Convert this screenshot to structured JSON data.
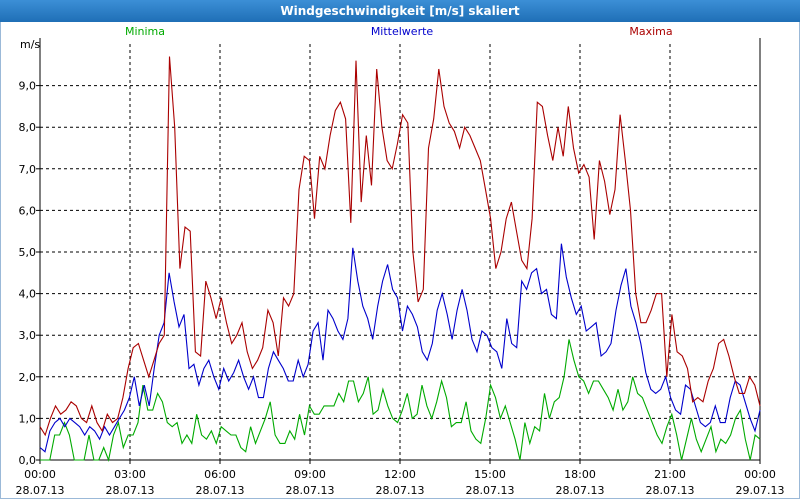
{
  "window": {
    "title": "Windgeschwindigkeit [m/s] skaliert"
  },
  "chart_data": {
    "type": "line",
    "title": "Windgeschwindigkeit [m/s] skaliert",
    "ylabel": "m/s",
    "ylim": [
      0,
      10
    ],
    "y_ticks": [
      "0,0",
      "1,0",
      "2,0",
      "3,0",
      "4,0",
      "5,0",
      "6,0",
      "7,0",
      "8,0",
      "9,0"
    ],
    "x_ticks": [
      {
        "time": "00:00",
        "date": "28.07.13"
      },
      {
        "time": "03:00",
        "date": "28.07.13"
      },
      {
        "time": "06:00",
        "date": "28.07.13"
      },
      {
        "time": "09:00",
        "date": "28.07.13"
      },
      {
        "time": "12:00",
        "date": "28.07.13"
      },
      {
        "time": "15:00",
        "date": "28.07.13"
      },
      {
        "time": "18:00",
        "date": "28.07.13"
      },
      {
        "time": "21:00",
        "date": "28.07.13"
      },
      {
        "time": "00:00",
        "date": "29.07.13"
      }
    ],
    "grid": true,
    "series": [
      {
        "name": "Minima",
        "color": "#00aa00",
        "values": [
          0.0,
          0.0,
          0.0,
          0.6,
          0.6,
          0.9,
          0.6,
          0.0,
          0.0,
          0.0,
          0.6,
          0.0,
          0.0,
          0.3,
          0.0,
          0.6,
          0.9,
          0.3,
          0.6,
          0.6,
          0.9,
          1.8,
          1.2,
          1.2,
          1.6,
          1.4,
          0.9,
          0.8,
          0.9,
          0.4,
          0.6,
          0.4,
          1.1,
          0.6,
          0.5,
          0.7,
          0.4,
          0.8,
          0.7,
          0.6,
          0.6,
          0.3,
          0.2,
          0.8,
          0.4,
          0.7,
          1.0,
          1.4,
          0.6,
          0.4,
          0.4,
          0.7,
          0.5,
          1.1,
          0.6,
          1.3,
          1.1,
          1.1,
          1.3,
          1.3,
          1.3,
          1.6,
          1.4,
          1.9,
          1.9,
          1.4,
          1.6,
          2.0,
          1.1,
          1.2,
          1.7,
          1.3,
          1.0,
          0.9,
          1.2,
          1.6,
          1.0,
          1.1,
          1.8,
          1.3,
          1.0,
          1.4,
          1.9,
          1.5,
          0.8,
          0.9,
          0.9,
          1.4,
          0.7,
          0.5,
          0.4,
          1.0,
          1.8,
          1.5,
          1.0,
          1.3,
          0.9,
          0.5,
          0.0,
          0.9,
          0.4,
          0.8,
          0.7,
          1.6,
          1.0,
          1.4,
          1.5,
          2.0,
          2.9,
          2.4,
          2.0,
          1.9,
          1.6,
          1.9,
          1.9,
          1.7,
          1.5,
          1.2,
          1.7,
          1.2,
          1.4,
          2.0,
          1.6,
          1.5,
          1.2,
          0.9,
          0.6,
          0.4,
          0.8,
          1.1,
          0.6,
          0.0,
          0.5,
          1.0,
          0.5,
          0.2,
          0.5,
          0.8,
          0.2,
          0.5,
          0.4,
          0.6,
          1.0,
          1.2,
          0.5,
          0.0,
          0.6,
          0.5
        ]
      },
      {
        "name": "Mittelwerte",
        "color": "#0000cc",
        "values": [
          0.3,
          0.2,
          0.7,
          0.9,
          1.0,
          0.8,
          1.0,
          0.9,
          0.8,
          0.6,
          0.8,
          0.7,
          0.5,
          0.8,
          0.6,
          0.8,
          1.0,
          1.2,
          1.5,
          2.0,
          1.3,
          1.8,
          1.3,
          2.2,
          3.0,
          3.3,
          4.5,
          3.8,
          3.2,
          3.5,
          2.2,
          2.3,
          1.8,
          2.2,
          2.4,
          2.0,
          1.7,
          2.2,
          1.9,
          2.1,
          2.4,
          2.0,
          1.7,
          2.0,
          1.5,
          1.5,
          2.2,
          2.6,
          2.4,
          2.2,
          1.9,
          1.9,
          2.4,
          2.0,
          2.3,
          3.1,
          3.3,
          2.4,
          3.6,
          3.4,
          3.1,
          2.9,
          3.4,
          5.1,
          4.3,
          3.7,
          3.4,
          2.9,
          3.7,
          4.3,
          4.7,
          4.1,
          3.9,
          3.1,
          3.7,
          3.5,
          3.2,
          2.6,
          2.4,
          2.8,
          3.6,
          4.0,
          3.5,
          2.9,
          3.6,
          4.1,
          3.6,
          2.9,
          2.6,
          3.1,
          3.0,
          2.7,
          2.6,
          2.2,
          3.4,
          2.8,
          2.7,
          4.3,
          4.1,
          4.5,
          4.6,
          4.0,
          4.1,
          3.5,
          3.4,
          5.2,
          4.4,
          3.9,
          3.5,
          3.7,
          3.1,
          3.2,
          3.3,
          2.5,
          2.6,
          2.8,
          3.6,
          4.2,
          4.6,
          3.7,
          3.3,
          2.8,
          2.1,
          1.7,
          1.6,
          1.7,
          2.0,
          1.5,
          1.2,
          1.1,
          1.8,
          1.7,
          1.3,
          0.9,
          0.8,
          0.9,
          1.3,
          0.9,
          0.9,
          1.5,
          1.9,
          1.8,
          1.4,
          1.0,
          0.7,
          1.2
        ]
      },
      {
        "name": "Maxima",
        "color": "#aa0000",
        "values": [
          0.8,
          0.6,
          1.0,
          1.3,
          1.1,
          1.2,
          1.4,
          1.3,
          1.0,
          0.9,
          1.3,
          0.9,
          0.7,
          1.1,
          0.9,
          1.0,
          1.5,
          2.2,
          2.7,
          2.8,
          2.4,
          2.0,
          2.4,
          2.8,
          3.0,
          9.7,
          8.0,
          4.6,
          5.6,
          5.5,
          2.6,
          2.5,
          4.3,
          3.9,
          3.4,
          3.9,
          3.3,
          2.8,
          3.0,
          3.3,
          2.6,
          2.2,
          2.4,
          2.7,
          3.6,
          3.3,
          2.5,
          3.9,
          3.7,
          4.0,
          6.5,
          7.3,
          7.2,
          5.8,
          7.3,
          7.0,
          7.8,
          8.4,
          8.6,
          8.2,
          5.7,
          9.6,
          6.2,
          7.8,
          6.6,
          9.4,
          8.0,
          7.2,
          7.0,
          7.6,
          8.3,
          8.1,
          5.0,
          3.8,
          4.1,
          7.5,
          8.2,
          9.4,
          8.5,
          8.1,
          7.9,
          7.5,
          8.0,
          7.8,
          7.5,
          7.2,
          6.5,
          5.8,
          4.6,
          5.0,
          5.8,
          6.2,
          5.5,
          4.8,
          4.6,
          5.8,
          8.6,
          8.5,
          7.8,
          7.2,
          8.0,
          7.3,
          8.5,
          7.5,
          6.9,
          7.1,
          6.8,
          5.3,
          7.2,
          6.7,
          5.9,
          6.5,
          8.3,
          7.2,
          6.0,
          4.0,
          3.3,
          3.3,
          3.6,
          4.0,
          4.0,
          2.0,
          3.5,
          2.6,
          2.5,
          2.2,
          1.4,
          1.5,
          1.4,
          1.9,
          2.2,
          2.8,
          2.9,
          2.5,
          2.0,
          1.6,
          1.6,
          2.0,
          1.8,
          1.3
        ]
      }
    ]
  }
}
